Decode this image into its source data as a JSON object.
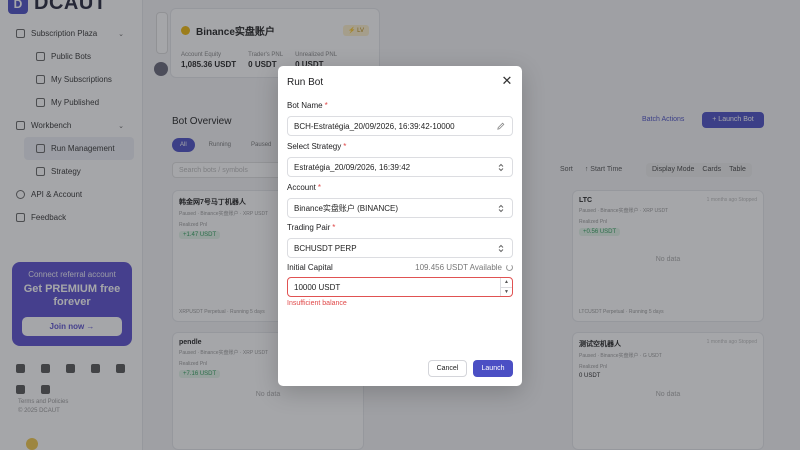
{
  "app": {
    "logo_text": "DCAUT",
    "sidebar": {
      "sections": [
        {
          "label": "Subscription Plaza",
          "items": [
            "Public Bots",
            "My Subscriptions",
            "My Published"
          ]
        },
        {
          "label": "Workbench",
          "items": [
            "Run Management",
            "Strategy"
          ]
        }
      ],
      "api_account": "API & Account",
      "feedback": "Feedback"
    },
    "promo": {
      "line1": "Connect referral account",
      "line2": "Get PREMIUM free forever",
      "button": "Join now →"
    },
    "footer": {
      "terms": "Terms and Policies",
      "copyright": "© 2025 DCAUT"
    },
    "account_card": {
      "name": "Binance实盘账户",
      "badge": "⚡ LV",
      "stats": [
        {
          "label": "Account Equity",
          "value": "1,085.36 USDT"
        },
        {
          "label": "Trader's PNL",
          "value": "0 USDT"
        },
        {
          "label": "Unrealized PNL",
          "value": "0 USDT"
        }
      ]
    },
    "overview": {
      "title": "Bot Overview",
      "batch_actions": "Batch Actions",
      "launch_bot": "+ Launch Bot",
      "filters": [
        "All",
        "Running",
        "Paused"
      ],
      "search_placeholder": "Search bots / symbols",
      "sort": "Sort",
      "start_time": "↑ Start Time",
      "display_mode": "Display Mode",
      "cards": "Cards",
      "table": "Table"
    },
    "bots": [
      {
        "name": "韩金网7号马丁机器人",
        "meta": "Paused · Binance实盘账户 · XRP USDT",
        "realized_label": "Realized Pnl",
        "realized": "+1.47 USDT",
        "footer": "XRPUSDT Perpetual · Running 5 days"
      },
      {
        "name": "LTC",
        "meta": "Paused · Binance实盘账户 · XRP USDT",
        "realized_label": "Realized Pnl",
        "realized": "+0.56 USDT",
        "unrealized_label": "Unrealized Pnl",
        "unrealized": "0 USDT",
        "nodata": "No data",
        "time": "1 months ago Stopped",
        "footer": "LTCUSDT Perpetual · Running 5 days"
      },
      {
        "name": "pendle",
        "meta": "Paused · Binance实盘账户 · XRP USDT",
        "realized_label": "Realized Pnl",
        "realized": "+7.16 USDT",
        "nodata": "No data"
      },
      {
        "name": "测试空机器人",
        "meta": "Paused · Binance实盘账户 · G USDT",
        "realized_label": "Realized Pnl",
        "realized": "0 USDT",
        "unrealized_label": "Unrealized Pnl",
        "unrealized": "0 USDT",
        "nodata": "No data",
        "time": "1 months ago Stopped"
      }
    ]
  },
  "modal": {
    "title": "Run Bot",
    "close": "✕",
    "bot_name": {
      "label": "Bot Name",
      "value": "BCH-Estratégia_20/09/2026, 16:39:42-10000"
    },
    "strategy": {
      "label": "Select Strategy",
      "value": "Estratégia_20/09/2026, 16:39:42"
    },
    "account": {
      "label": "Account",
      "value": "Binance实盘账户 (BINANCE)"
    },
    "pair": {
      "label": "Trading Pair",
      "value": "BCHUSDT PERP"
    },
    "capital": {
      "label": "Initial Capital",
      "available": "109.456 USDT Available",
      "value": "10000 USDT",
      "error": "Insufficient balance"
    },
    "cancel": "Cancel",
    "launch": "Launch"
  }
}
